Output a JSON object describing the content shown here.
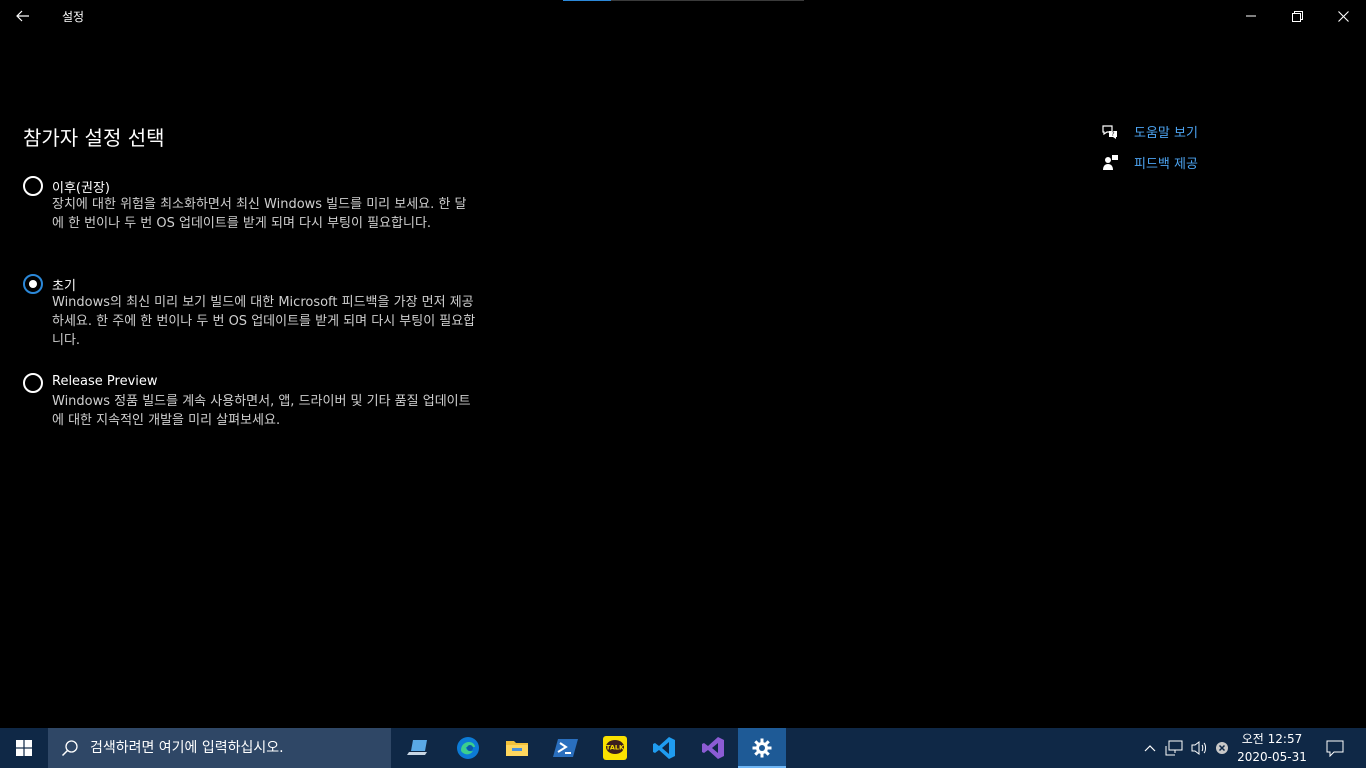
{
  "window": {
    "title": "설정",
    "progress": 0.2
  },
  "content": {
    "heading": "참가자 설정 선택",
    "options": [
      {
        "label": "이후(권장)",
        "description": "장치에 대한 위험을 최소화하면서 최신 Windows 빌드를 미리 보세요. 한 달에 한 번이나 두 번 OS 업데이트를 받게 되며 다시 부팅이 필요합니다.",
        "selected": false
      },
      {
        "label": "초기",
        "description": "Windows의 최신 미리 보기 빌드에 대한 Microsoft 피드백을 가장 먼저 제공하세요. 한 주에 한 번이나 두 번 OS 업데이트를 받게 되며 다시 부팅이 필요합니다.",
        "selected": true
      },
      {
        "label": "Release Preview",
        "description": "Windows 정품 빌드를 계속 사용하면서, 앱, 드라이버 및 기타 품질 업데이트에 대한 지속적인 개발을 미리 살펴보세요.",
        "selected": false
      }
    ],
    "side_links": [
      {
        "label": "도움말 보기",
        "icon": "help-chat-icon"
      },
      {
        "label": "피드백 제공",
        "icon": "feedback-person-icon"
      }
    ]
  },
  "taskbar": {
    "search_placeholder": "검색하려면 여기에 입력하십시오.",
    "apps": [
      {
        "name": "computer-app",
        "icon": "laptop-icon"
      },
      {
        "name": "edge",
        "icon": "edge-icon"
      },
      {
        "name": "file-explorer",
        "icon": "folder-icon"
      },
      {
        "name": "powershell",
        "icon": "powershell-icon"
      },
      {
        "name": "kakaotalk",
        "icon": "kakaotalk-icon",
        "badge": "TALK"
      },
      {
        "name": "vscode",
        "icon": "vscode-icon"
      },
      {
        "name": "visual-studio",
        "icon": "visual-studio-icon"
      },
      {
        "name": "settings",
        "icon": "gear-icon",
        "active": true
      }
    ],
    "clock": {
      "time": "오전 12:57",
      "date": "2020-05-31"
    }
  },
  "colors": {
    "accent": "#2b88d8",
    "link": "#4ca3f0",
    "taskbar": "#0f2846",
    "search_bg": "#2f4766"
  }
}
